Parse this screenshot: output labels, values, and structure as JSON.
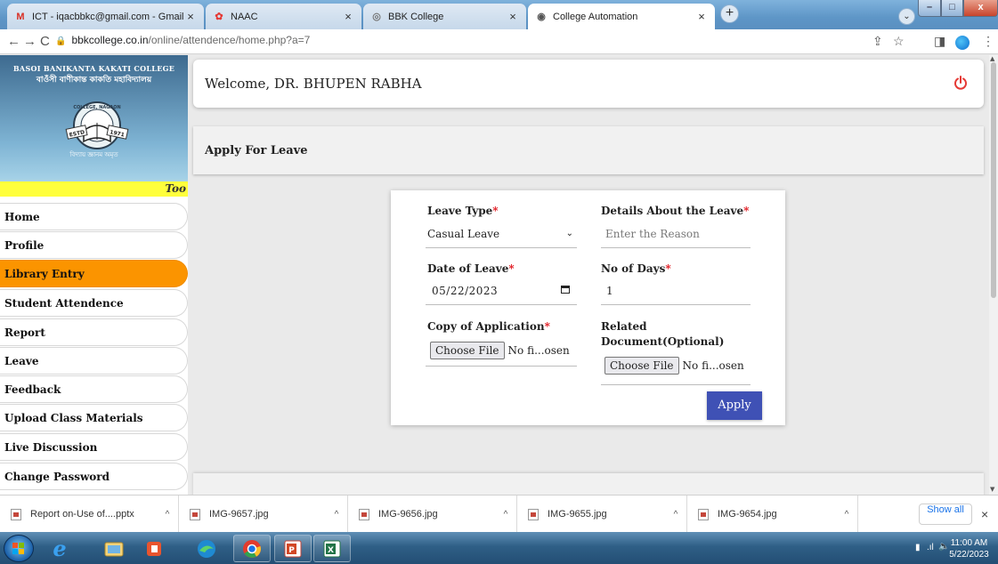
{
  "browser": {
    "tabs": [
      {
        "title": "ICT - iqacbbkc@gmail.com - Gmail",
        "favicon": "gmail-icon",
        "favicon_glyph": "M",
        "active": false
      },
      {
        "title": "NAAC",
        "favicon": "naac-icon",
        "favicon_glyph": "✿",
        "active": false
      },
      {
        "title": "BBK College",
        "favicon": "globe-icon",
        "favicon_glyph": "◎",
        "active": false
      },
      {
        "title": "College Automation",
        "favicon": "globe-icon",
        "favicon_glyph": "◉",
        "active": true
      }
    ],
    "close_glyph": "×",
    "new_tab_glyph": "+",
    "url_host": "bbkcollege.co.in",
    "url_path": "/online/attendence/home.php?a=7"
  },
  "sidebar": {
    "college_name_en": "BASOI BANIKANTA KAKATI COLLEGE",
    "college_name_as": "বাওঁসী বাণীকান্ত কাকতি মহাবিদ্যালয়",
    "seal_top": "COLLEGE, NAGAON",
    "seal_estd": "ESTD",
    "seal_year": "1971",
    "motto": "বিদ্যায় জ্ঞানম অমৃত",
    "marquee": "Too",
    "items": [
      {
        "label": "Home"
      },
      {
        "label": "Profile"
      },
      {
        "label": "Library Entry"
      },
      {
        "label": "Student Attendence"
      },
      {
        "label": "Report"
      },
      {
        "label": "Leave"
      },
      {
        "label": "Feedback"
      },
      {
        "label": "Upload Class Materials"
      },
      {
        "label": "Live Discussion"
      },
      {
        "label": "Change Password"
      }
    ],
    "active_item": "Library Entry",
    "active_color": "#fb9400"
  },
  "header": {
    "welcome": "Welcome, DR. BHUPEN RABHA",
    "power_color": "#e53935"
  },
  "page": {
    "title": "Apply For Leave"
  },
  "form": {
    "required_mark": "*",
    "leave_type_label": "Leave Type",
    "leave_type_value": "Casual Leave",
    "details_label": "Details About the Leave",
    "details_placeholder": "Enter the Reason",
    "date_label": "Date of Leave",
    "date_value": "05/22/2023",
    "days_label": "No of Days",
    "days_value": "1",
    "application_label": "Copy of Application",
    "related_label_line1": "Related",
    "related_label_line2": "Document(Optional)",
    "choose_file": "Choose File",
    "no_file": "No fi...osen",
    "apply": "Apply",
    "apply_color": "#3f51b5"
  },
  "downloads": {
    "items": [
      {
        "name": "Report on-Use of....pptx"
      },
      {
        "name": "IMG-9657.jpg"
      },
      {
        "name": "IMG-9656.jpg"
      },
      {
        "name": "IMG-9655.jpg"
      },
      {
        "name": "IMG-9654.jpg"
      }
    ],
    "caret_glyph": "^",
    "show_all": "Show all",
    "close_glyph": "×"
  },
  "taskbar": {
    "time": "11:00 AM",
    "date": "5/22/2023",
    "pinned": [
      "ie-icon",
      "explorer-icon",
      "office-icon",
      "edge-icon",
      "chrome-icon",
      "powerpoint-icon",
      "excel-icon"
    ]
  }
}
